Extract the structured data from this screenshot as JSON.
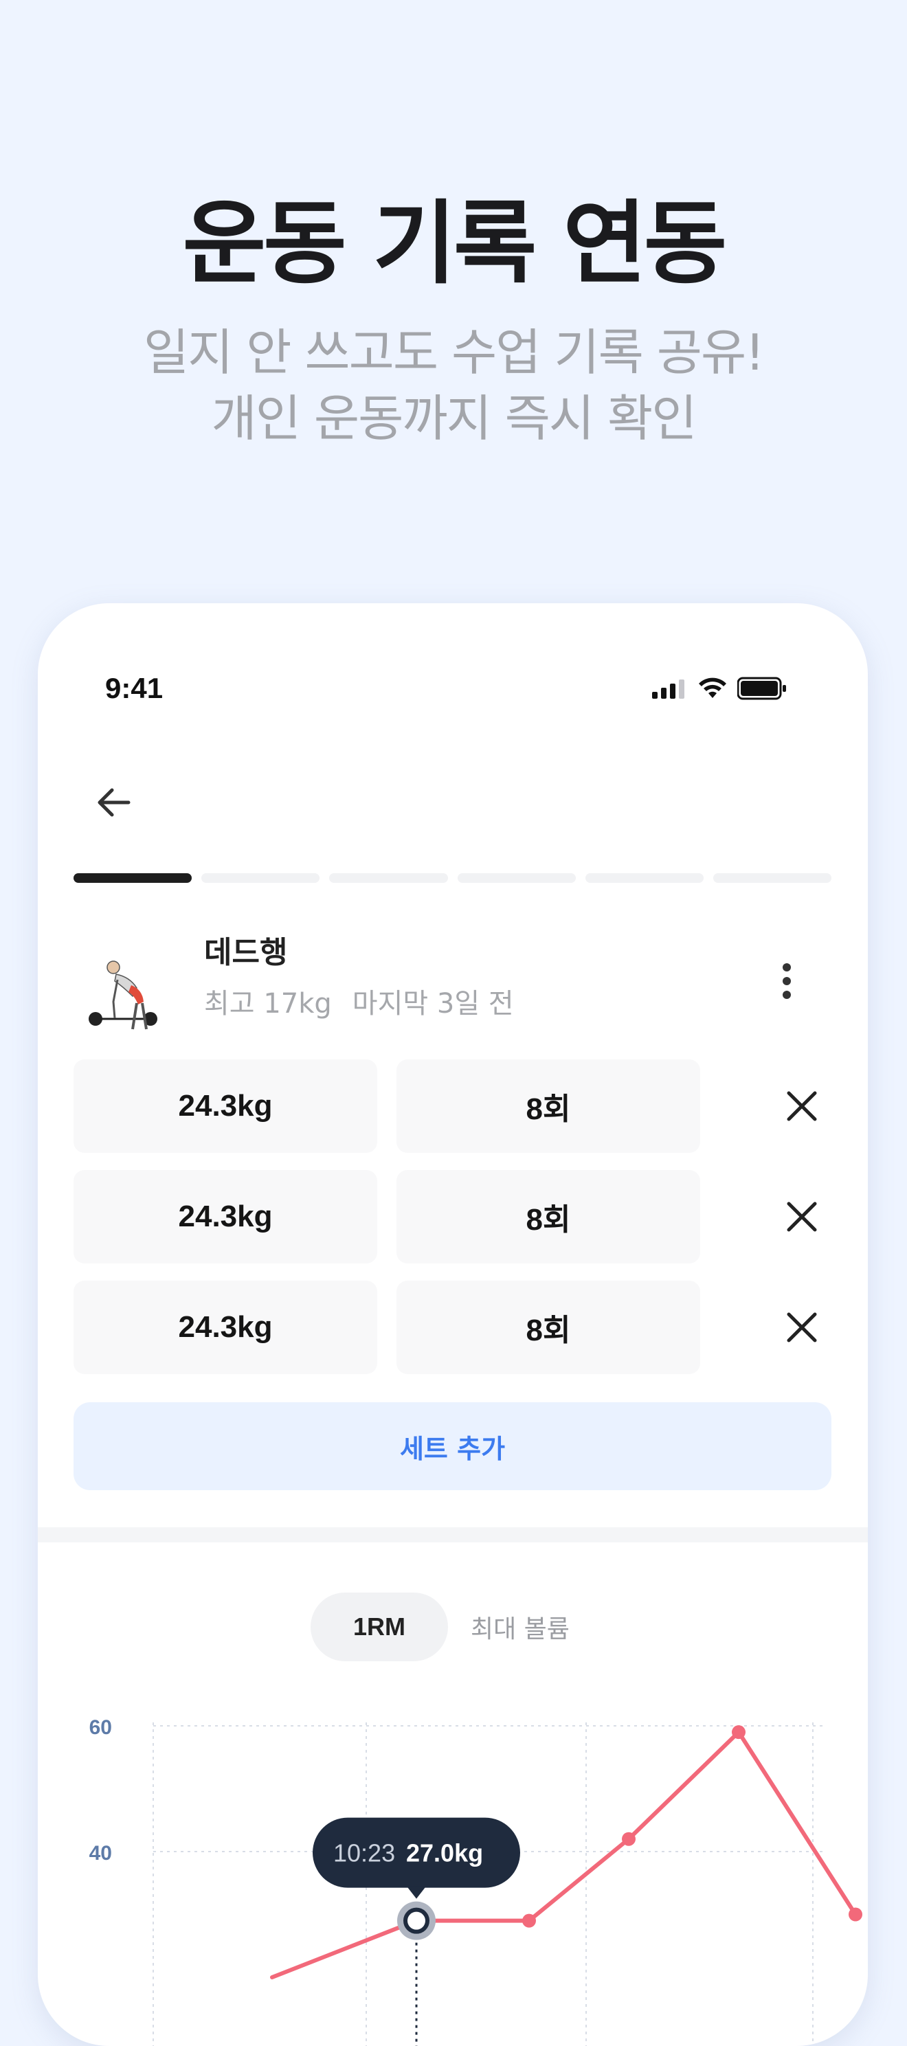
{
  "hero": {
    "title": "운동 기록 연동",
    "subtitle_line1": "일지 안 쓰고도 수업 기록 공유!",
    "subtitle_line2": "개인 운동까지 즉시 확인"
  },
  "status_bar": {
    "time": "9:41",
    "icons": [
      "signal-icon",
      "wifi-icon",
      "battery-icon"
    ]
  },
  "progress": {
    "total_steps": 6,
    "current_step": 1
  },
  "exercise": {
    "name": "데드행",
    "best": "최고 17kg",
    "last": "마지막 3일 전"
  },
  "sets": [
    {
      "weight": "24.3kg",
      "reps": "8회"
    },
    {
      "weight": "24.3kg",
      "reps": "8회"
    },
    {
      "weight": "24.3kg",
      "reps": "8회"
    }
  ],
  "add_set_label": "세트 추가",
  "tabs": {
    "active": "1RM",
    "inactive": "최대 볼륨"
  },
  "chart_data": {
    "type": "line",
    "y_ticks": [
      "60",
      "40"
    ],
    "ylim": [
      20,
      62
    ],
    "points": [
      {
        "x": 0,
        "y": 20
      },
      {
        "x": 1,
        "y": 29
      },
      {
        "x": 2,
        "y": 29
      },
      {
        "x": 3,
        "y": 42
      },
      {
        "x": 4,
        "y": 59
      },
      {
        "x": 5,
        "y": 30
      }
    ],
    "tooltip": {
      "time": "10:23",
      "value": "27.0kg",
      "point_index": 1
    },
    "line_color": "#F2697A",
    "tooltip_color": "#1F2B3E"
  },
  "colors": {
    "accent": "#3C7BEF",
    "background": "#EEF4FF"
  }
}
